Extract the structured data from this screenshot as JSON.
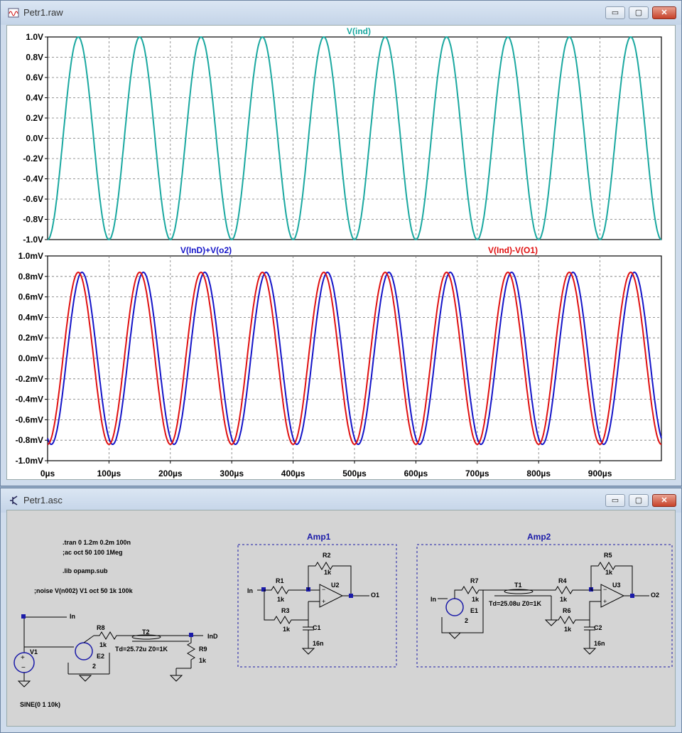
{
  "plot_window": {
    "title": "Petr1.raw",
    "controls": {
      "minimize": "▭",
      "restore": "▢",
      "close": "✕"
    }
  },
  "schematic_window": {
    "title": "Petr1.asc",
    "controls": {
      "minimize": "▭",
      "restore": "▢",
      "close": "✕"
    },
    "directives": [
      ".tran 0 1.2m 0.2m 100n",
      ";ac oct 50 100 1Meg",
      ".lib opamp.sub",
      ";noise V(n002) V1 oct 50 1k 100k"
    ],
    "source": {
      "name": "V1",
      "value": "SINE(0 1 10k)"
    },
    "blocks": [
      {
        "title": "Amp1"
      },
      {
        "title": "Amp2"
      }
    ],
    "labels": {
      "In": "In",
      "InD": "InD",
      "O1": "O1",
      "O2": "O2",
      "R8": "R8",
      "R8v": "1k",
      "E2": "E2",
      "E2v": "2",
      "T2": "T2",
      "T2v": "Td=25.72u Z0=1K",
      "R9": "R9",
      "R9v": "1k",
      "R1": "R1",
      "R1v": "1k",
      "R2": "R2",
      "R2v": "1k",
      "R3": "R3",
      "R3v": "1k",
      "U2": "U2",
      "C1": "C1",
      "C1v": "16n",
      "R7": "R7",
      "R7v": "1k",
      "E1": "E1",
      "E1v": "2",
      "T1": "T1",
      "T1v": "Td=25.08u Z0=1K",
      "R4": "R4",
      "R4v": "1k",
      "R5": "R5",
      "R5v": "1k",
      "R6": "R6",
      "R6v": "1k",
      "U3": "U3",
      "C2": "C2",
      "C2v": "16n"
    }
  },
  "chart_data": [
    {
      "type": "line",
      "series": [
        {
          "name": "V(ind)",
          "color": "#1aa8a0",
          "frequency_hz": 10000,
          "amplitude": 1.0,
          "phase_deg": -90
        }
      ],
      "ylim": [
        -1.0,
        1.0
      ],
      "yticks": [
        "1.0V",
        "0.8V",
        "0.6V",
        "0.4V",
        "0.2V",
        "0.0V",
        "-0.2V",
        "-0.4V",
        "-0.6V",
        "-0.8V",
        "-1.0V"
      ],
      "xlim_us": [
        0,
        1000
      ],
      "grid": true
    },
    {
      "type": "line",
      "series": [
        {
          "name": "V(InD)+V(o2)",
          "color": "#1414c8",
          "frequency_hz": 10000,
          "amplitude_mV": 0.84,
          "delay_us": 6
        },
        {
          "name": "V(Ind)-V(O1)",
          "color": "#e01010",
          "frequency_hz": 10000,
          "amplitude_mV": 0.84,
          "delay_us": 0
        }
      ],
      "ylim_mV": [
        -1.0,
        1.0
      ],
      "yticks": [
        "1.0mV",
        "0.8mV",
        "0.6mV",
        "0.4mV",
        "0.2mV",
        "0.0mV",
        "-0.2mV",
        "-0.4mV",
        "-0.6mV",
        "-0.8mV",
        "-1.0mV"
      ],
      "xticks": [
        "0µs",
        "100µs",
        "200µs",
        "300µs",
        "400µs",
        "500µs",
        "600µs",
        "700µs",
        "800µs",
        "900µs"
      ],
      "xlim_us": [
        0,
        1000
      ],
      "grid": true
    }
  ]
}
